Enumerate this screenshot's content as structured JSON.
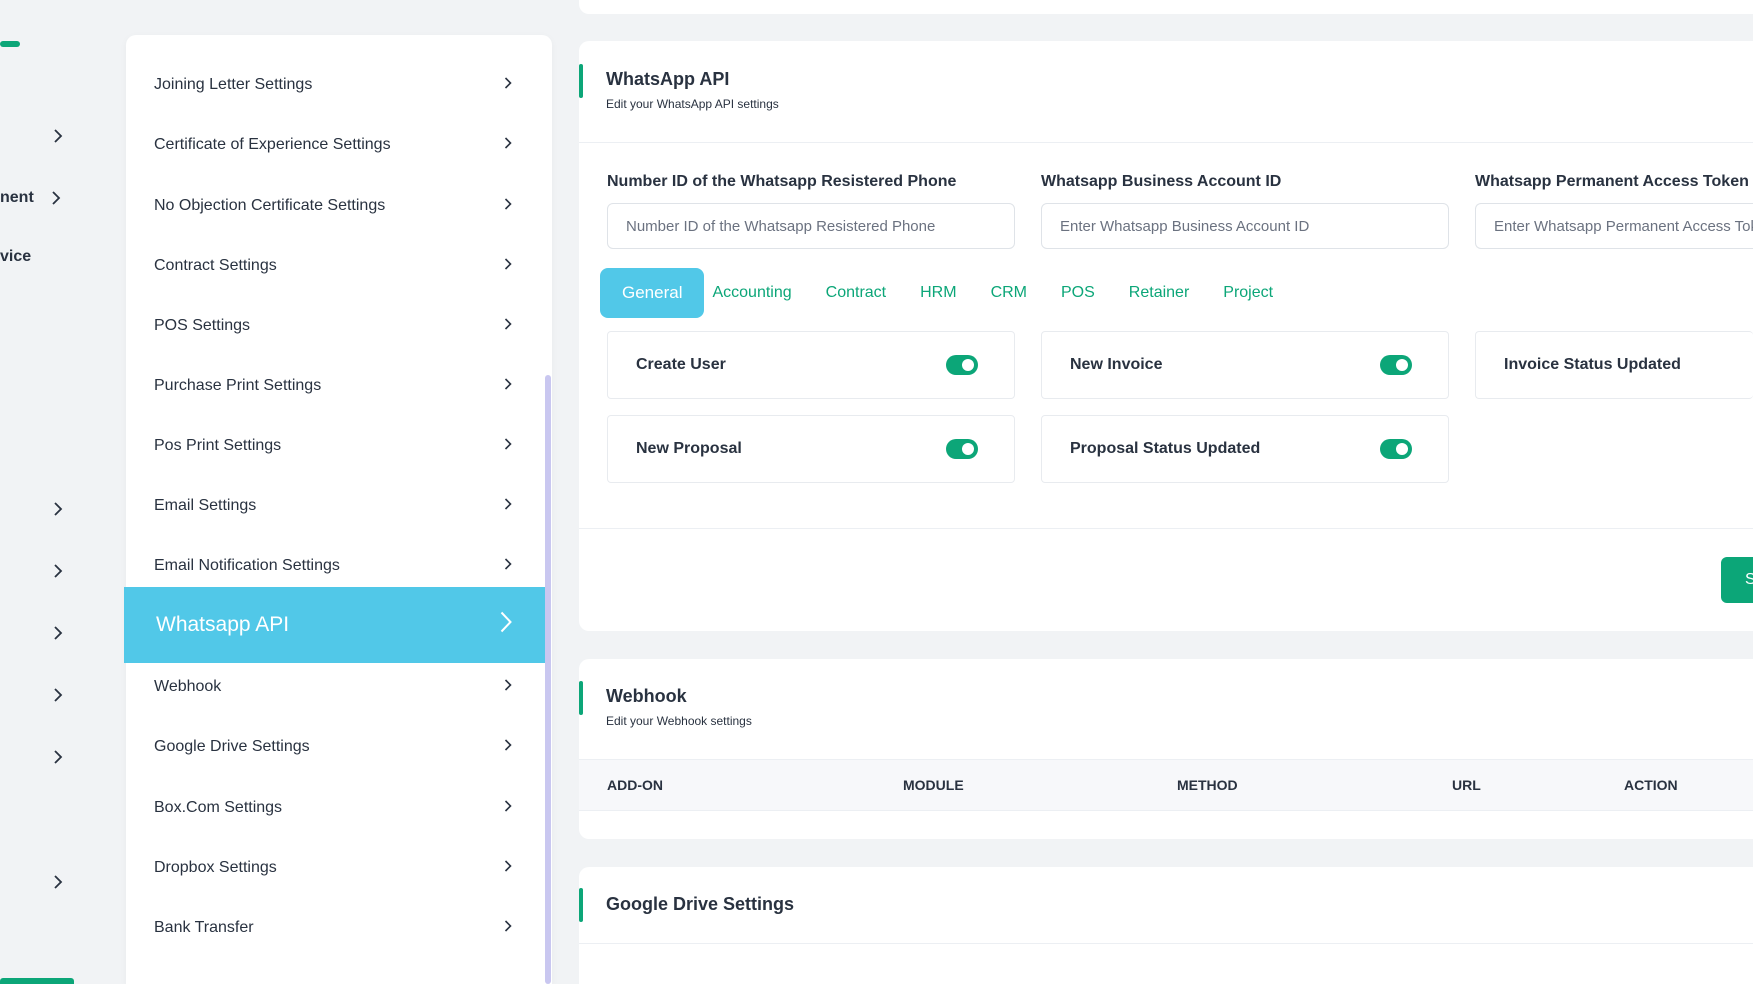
{
  "main_nav": {
    "items": [
      {
        "label": "",
        "has_chevron": true
      },
      {
        "label": "nent",
        "has_chevron": true
      },
      {
        "label": "vice",
        "has_chevron": false
      },
      {
        "label": "",
        "has_chevron": true
      },
      {
        "label": "",
        "has_chevron": true
      },
      {
        "label": "",
        "has_chevron": true
      },
      {
        "label": "",
        "has_chevron": true
      },
      {
        "label": "",
        "has_chevron": true
      },
      {
        "label": "",
        "has_chevron": true
      }
    ]
  },
  "settings_menu": {
    "items": [
      {
        "label": "Joining Letter Settings",
        "active": false
      },
      {
        "label": "Certificate of Experience Settings",
        "active": false
      },
      {
        "label": "No Objection Certificate Settings",
        "active": false
      },
      {
        "label": "Contract Settings",
        "active": false
      },
      {
        "label": "POS Settings",
        "active": false
      },
      {
        "label": "Purchase Print Settings",
        "active": false
      },
      {
        "label": "Pos Print Settings",
        "active": false
      },
      {
        "label": "Email Settings",
        "active": false
      },
      {
        "label": "Email Notification Settings",
        "active": false
      },
      {
        "label": "Whatsapp API",
        "active": true
      },
      {
        "label": "Webhook",
        "active": false
      },
      {
        "label": "Google Drive Settings",
        "active": false
      },
      {
        "label": "Box.Com Settings",
        "active": false
      },
      {
        "label": "Dropbox Settings",
        "active": false
      },
      {
        "label": "Bank Transfer",
        "active": false
      }
    ]
  },
  "whatsapp": {
    "title": "WhatsApp API",
    "subtitle": "Edit your WhatsApp API settings",
    "fields": [
      {
        "label": "Number ID of the Whatsapp Resistered Phone",
        "placeholder": "Number ID of the Whatsapp Resistered Phone"
      },
      {
        "label": "Whatsapp Business Account ID",
        "placeholder": "Enter Whatsapp Business Account ID"
      },
      {
        "label": "Whatsapp Permanent Access Token",
        "placeholder": "Enter Whatsapp Permanent Access Token"
      }
    ],
    "tabs": [
      "General",
      "Accounting",
      "Contract",
      "HRM",
      "CRM",
      "POS",
      "Retainer",
      "Project"
    ],
    "active_tab": "General",
    "notifications": [
      {
        "label": "Create User",
        "enabled": true
      },
      {
        "label": "New Invoice",
        "enabled": true
      },
      {
        "label": "Invoice Status Updated",
        "enabled": true
      },
      {
        "label": "New Proposal",
        "enabled": true
      },
      {
        "label": "Proposal Status Updated",
        "enabled": true
      }
    ],
    "save_label": "S"
  },
  "webhook": {
    "title": "Webhook",
    "subtitle": "Edit your Webhook settings",
    "columns": [
      "ADD-ON",
      "MODULE",
      "METHOD",
      "URL",
      "ACTION"
    ]
  },
  "google_drive": {
    "title": "Google Drive Settings"
  },
  "colors": {
    "accent_green": "#0ca678",
    "active_blue": "#51c8e8",
    "scrollbar": "#c9c7f0"
  }
}
